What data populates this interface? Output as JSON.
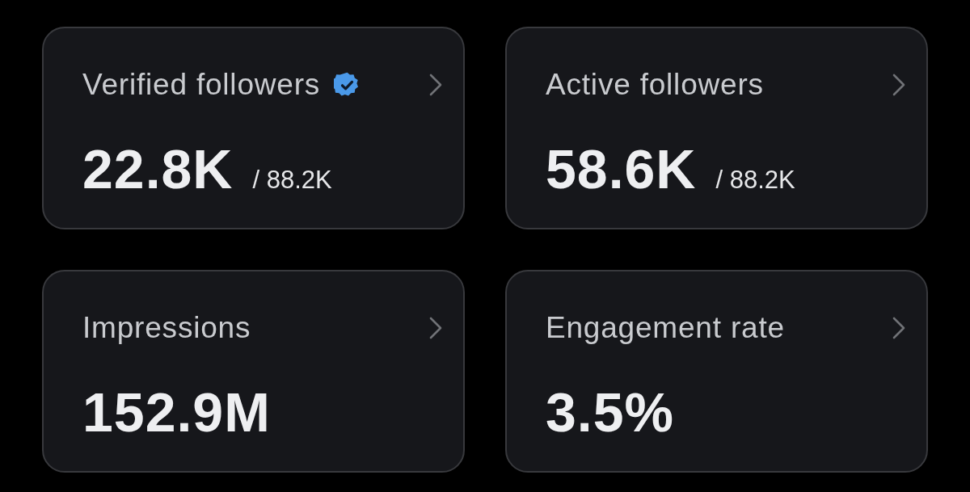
{
  "cards": [
    {
      "title": "Verified followers",
      "verified": true,
      "value": "22.8K",
      "total": "/ 88.2K"
    },
    {
      "title": "Active followers",
      "verified": false,
      "value": "58.6K",
      "total": "/ 88.2K"
    },
    {
      "title": "Impressions",
      "verified": false,
      "value": "152.9M"
    },
    {
      "title": "Engagement rate",
      "verified": false,
      "value": "3.5%"
    }
  ]
}
